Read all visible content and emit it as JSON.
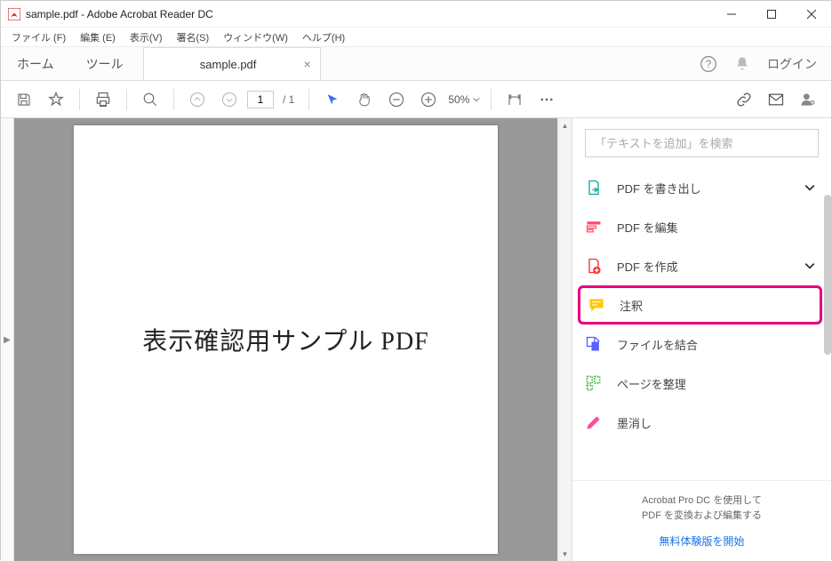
{
  "titlebar": {
    "title": "sample.pdf - Adobe Acrobat Reader DC"
  },
  "menu": {
    "items": [
      "ファイル (F)",
      "編集 (E)",
      "表示(V)",
      "署名(S)",
      "ウィンドウ(W)",
      "ヘルプ(H)"
    ]
  },
  "tabs": {
    "home": "ホーム",
    "tools": "ツール",
    "file": "sample.pdf",
    "login": "ログイン"
  },
  "toolbar": {
    "page_current": "1",
    "page_total": "/ 1",
    "zoom": "50%"
  },
  "document": {
    "body_title": "表示確認用サンプル PDF"
  },
  "rightpanel": {
    "search_placeholder": "「テキストを追加」を検索",
    "items": [
      {
        "icon": "export",
        "label": "PDF を書き出し",
        "expandable": true
      },
      {
        "icon": "edit",
        "label": "PDF を編集",
        "expandable": false
      },
      {
        "icon": "create",
        "label": "PDF を作成",
        "expandable": true
      },
      {
        "icon": "comment",
        "label": "注釈",
        "expandable": false,
        "highlighted": true
      },
      {
        "icon": "combine",
        "label": "ファイルを結合",
        "expandable": false
      },
      {
        "icon": "organize",
        "label": "ページを整理",
        "expandable": false
      },
      {
        "icon": "redact",
        "label": "墨消し",
        "expandable": false
      }
    ],
    "footer_line1": "Acrobat Pro DC を使用して",
    "footer_line2": "PDF を変換および編集する",
    "footer_link": "無料体験版を開始"
  }
}
